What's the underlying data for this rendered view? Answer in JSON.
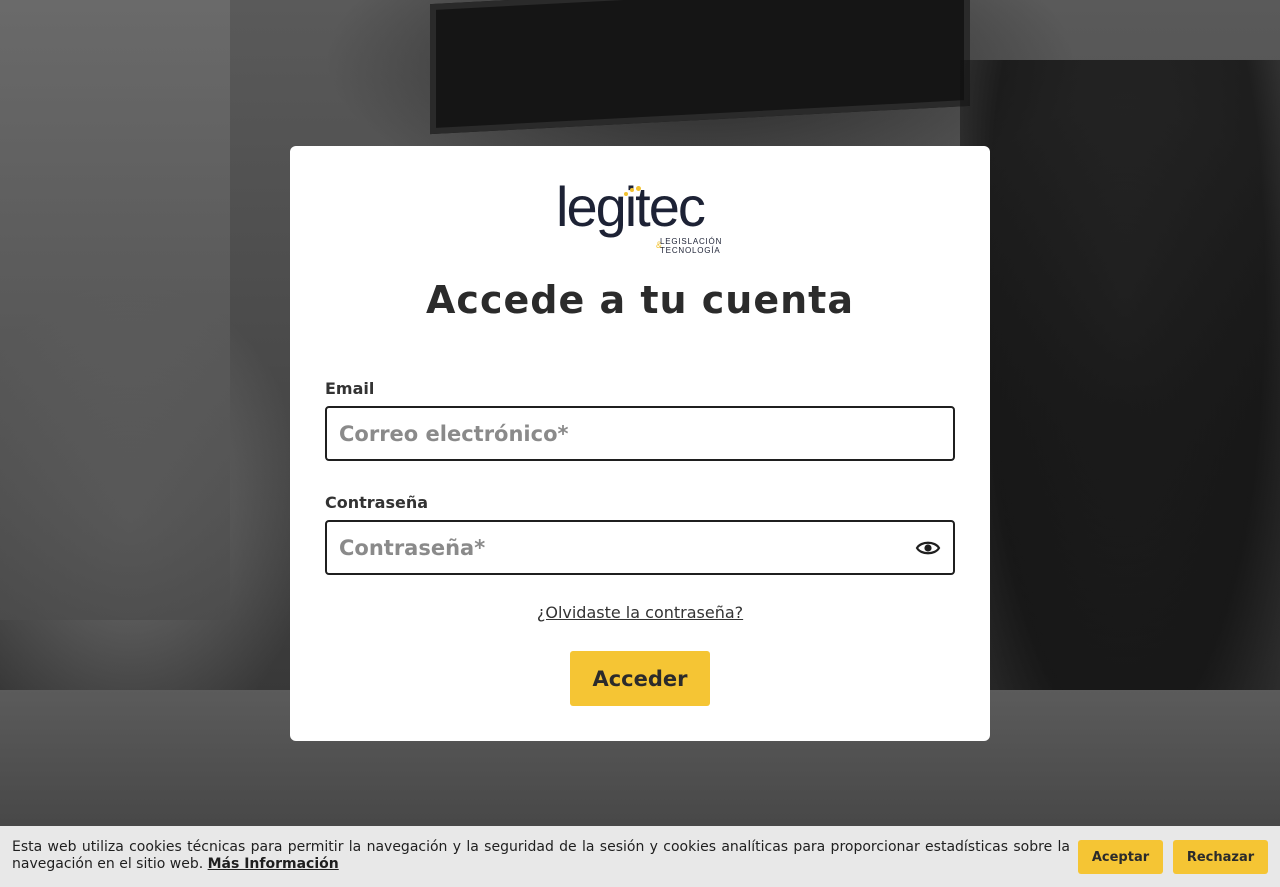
{
  "brand": {
    "name": "legitec",
    "tagline_line1": "LEGISLACIÓN",
    "tagline_line2": "TECNOLOGÍA",
    "tagline_amp": "&",
    "accent_color": "#f5c534",
    "dark_color": "#1d2235"
  },
  "login": {
    "title": "Accede a tu cuenta",
    "email_label": "Email",
    "email_placeholder": "Correo electrónico*",
    "password_label": "Contraseña",
    "password_placeholder": "Contraseña*",
    "show_password_icon": "eye-icon",
    "forgot_link": "¿Olvidaste la contraseña?",
    "submit_label": "Acceder"
  },
  "cookies": {
    "message": "Esta web utiliza cookies técnicas para permitir la navegación y la seguridad de la sesión y cookies analíticas para proporcionar estadísticas sobre la navegación en el sitio web.",
    "more_info_link": "Más Información",
    "accept_label": "Aceptar",
    "reject_label": "Rechazar"
  }
}
